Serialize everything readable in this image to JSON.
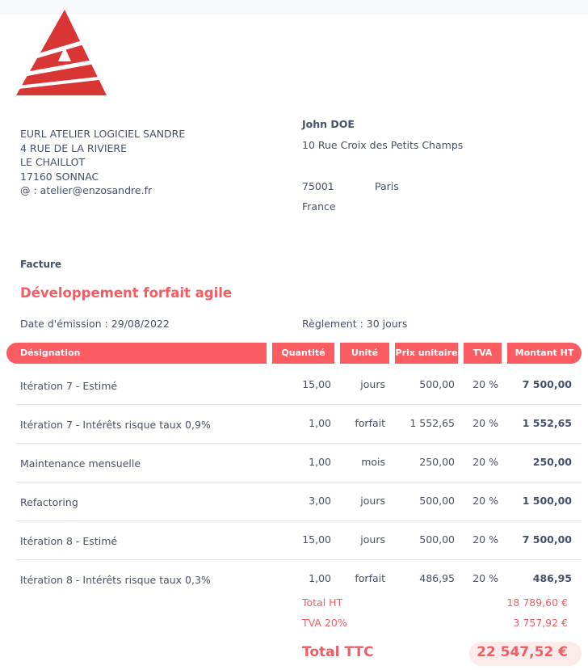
{
  "logo": {
    "icon": "atelier-logo-icon",
    "color": "#d93535"
  },
  "sender": {
    "name": "EURL ATELIER LOGICIEL SANDRE",
    "street": "4 RUE DE LA RIVIERE",
    "place": "LE CHAILLOT",
    "zip_city": "17160 SONNAC",
    "email": "@ : atelier@enzosandre.fr"
  },
  "client": {
    "name": "John DOE",
    "street": "10 Rue Croix des Petits Champs",
    "zip": "75001",
    "city": "Paris",
    "country": "France"
  },
  "document": {
    "type": "Facture",
    "title": "Développement forfait agile",
    "issue_date": "Date d'émission : 29/08/2022",
    "payment_terms": "Règlement : 30 jours"
  },
  "table": {
    "headers": {
      "designation": "Désignation",
      "quantity": "Quantité",
      "unit": "Unité",
      "unit_price": "Prix unitaire",
      "tva": "TVA",
      "amount": "Montant HT"
    },
    "rows": [
      {
        "designation": "Itération 7 - Estimé",
        "quantity": "15,00",
        "unit": "jours",
        "unit_price": "500,00",
        "tva": "20 %",
        "amount": "7 500,00"
      },
      {
        "designation": "Itération 7 - Intérêts risque taux 0,9%",
        "quantity": "1,00",
        "unit": "forfait",
        "unit_price": "1 552,65",
        "tva": "20 %",
        "amount": "1 552,65"
      },
      {
        "designation": "Maintenance mensuelle",
        "quantity": "1,00",
        "unit": "mois",
        "unit_price": "250,00",
        "tva": "20 %",
        "amount": "250,00"
      },
      {
        "designation": "Refactoring",
        "quantity": "3,00",
        "unit": "jours",
        "unit_price": "500,00",
        "tva": "20 %",
        "amount": "1 500,00"
      },
      {
        "designation": "Itération 8 - Estimé",
        "quantity": "15,00",
        "unit": "jours",
        "unit_price": "500,00",
        "tva": "20 %",
        "amount": "7 500,00"
      },
      {
        "designation": "Itération 8 - Intérêts risque taux 0,3%",
        "quantity": "1,00",
        "unit": "forfait",
        "unit_price": "486,95",
        "tva": "20 %",
        "amount": "486,95"
      }
    ]
  },
  "totals": {
    "ht_label": "Total HT",
    "ht_value": "18 789,60 €",
    "tva_label": "TVA 20%",
    "tva_value": "3 757,92 €",
    "ttc_label": "Total TTC",
    "ttc_value": "22 547,52 €"
  },
  "colors": {
    "accent": "#fb5c61",
    "accent_text": "#f25c62",
    "text": "#44516a",
    "pill": "#fdeaea"
  }
}
